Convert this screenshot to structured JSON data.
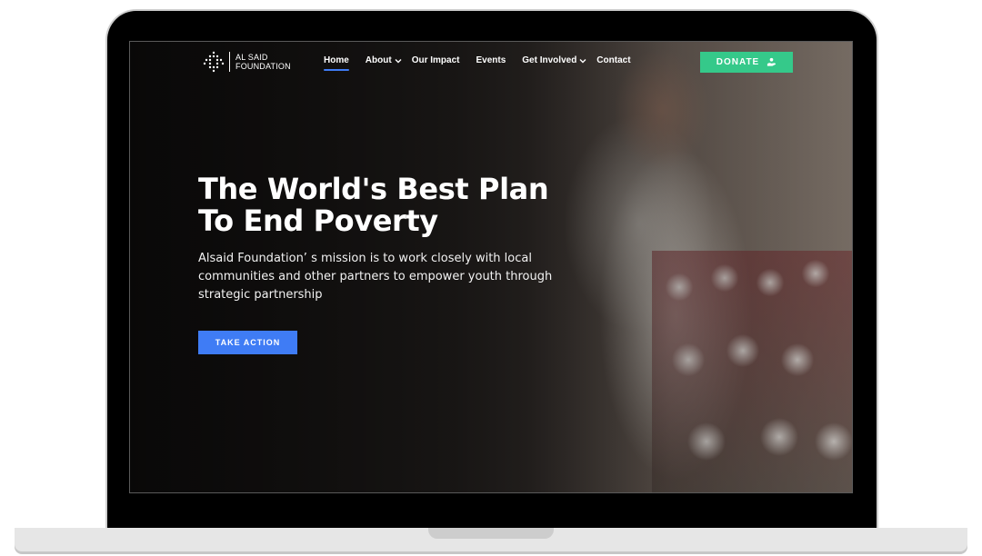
{
  "nav": {
    "logo": {
      "line1": "AL SAID",
      "line2": "FOUNDATION"
    },
    "items": [
      {
        "label": "Home",
        "active": true,
        "has_dropdown": false
      },
      {
        "label": "About",
        "active": false,
        "has_dropdown": true
      },
      {
        "label": "Our Impact",
        "active": false,
        "has_dropdown": false
      },
      {
        "label": "Events",
        "active": false,
        "has_dropdown": false
      },
      {
        "label": "Get Involved",
        "active": false,
        "has_dropdown": true
      },
      {
        "label": "Contact",
        "active": false,
        "has_dropdown": false
      }
    ],
    "donate_label": "DONATE",
    "donate_icon": "donate-hand-icon"
  },
  "hero": {
    "title_line1": "The World's Best Plan",
    "title_line2": "To End Poverty",
    "description": "Alsaid Foundation’ s mission is to work closely with local communities and other partners to empower youth through strategic partnership",
    "cta_label": "TAKE ACTION"
  },
  "colors": {
    "accent_blue": "#3f7cf5",
    "donate_green": "#35c98a",
    "text": "#ffffff"
  }
}
